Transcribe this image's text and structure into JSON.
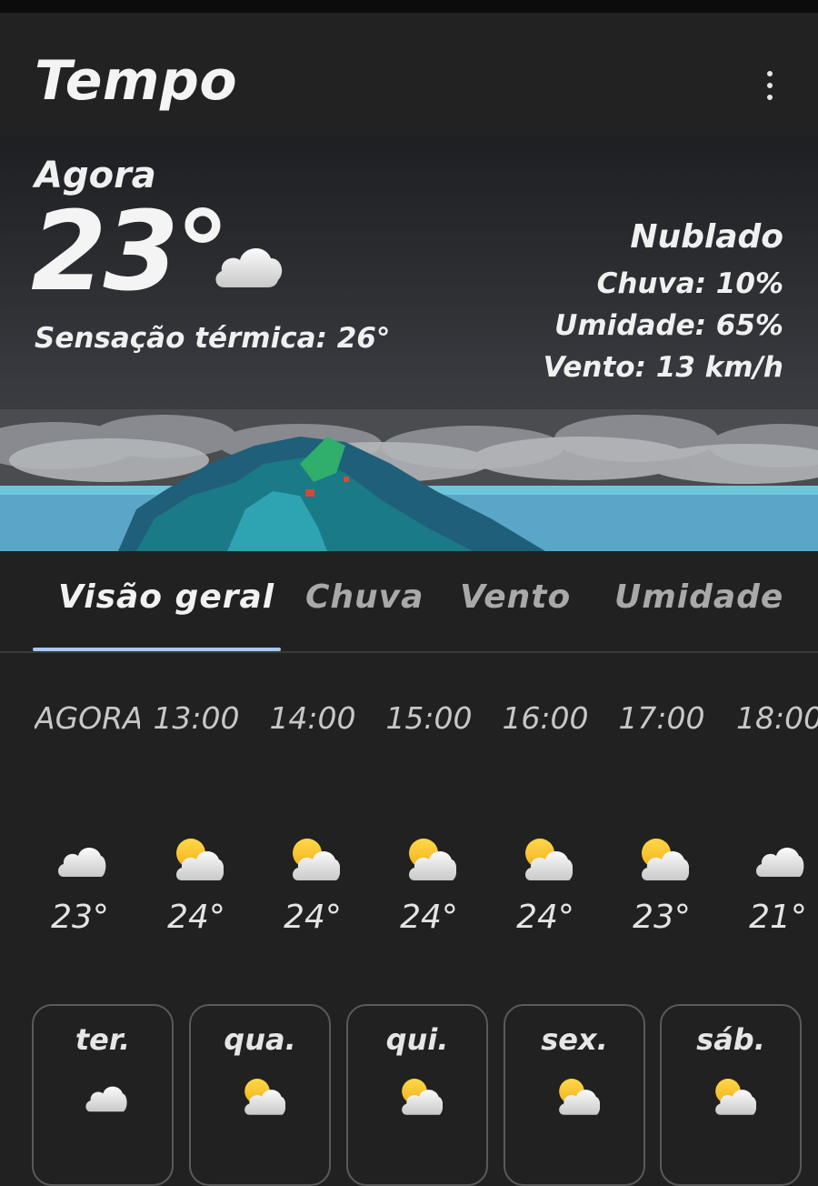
{
  "app": {
    "title": "Tempo"
  },
  "current": {
    "label": "Agora",
    "temperature": "23°",
    "condition_icon": "cloud-icon",
    "feels_like": "Sensação térmica: 26°",
    "description": "Nublado",
    "rain": "Chuva: 10%",
    "humidity": "Umidade: 65%",
    "wind": "Vento: 13 km/h"
  },
  "tabs": [
    {
      "label": "Visão geral",
      "active": true
    },
    {
      "label": "Chuva",
      "active": false
    },
    {
      "label": "Vento",
      "active": false
    },
    {
      "label": "Umidade",
      "active": false
    }
  ],
  "hourly": [
    {
      "time": "AGORA",
      "icon": "cloud-icon",
      "temp": "23°"
    },
    {
      "time": "13:00",
      "icon": "partly-cloudy-icon",
      "temp": "24°"
    },
    {
      "time": "14:00",
      "icon": "partly-cloudy-icon",
      "temp": "24°"
    },
    {
      "time": "15:00",
      "icon": "partly-cloudy-icon",
      "temp": "24°"
    },
    {
      "time": "16:00",
      "icon": "partly-cloudy-icon",
      "temp": "24°"
    },
    {
      "time": "17:00",
      "icon": "partly-cloudy-icon",
      "temp": "23°"
    },
    {
      "time": "18:00",
      "icon": "cloud-icon",
      "temp": "21°"
    }
  ],
  "daily": [
    {
      "day": "ter.",
      "icon": "cloud-icon"
    },
    {
      "day": "qua.",
      "icon": "partly-cloudy-icon"
    },
    {
      "day": "qui.",
      "icon": "partly-cloudy-icon"
    },
    {
      "day": "sex.",
      "icon": "partly-cloudy-icon"
    },
    {
      "day": "sáb.",
      "icon": "partly-cloudy-icon"
    }
  ],
  "colors": {
    "background": "#212121",
    "tab_indicator": "#a8c6f6",
    "sun": "#f9c62b",
    "cloud": "#e8e8e8"
  }
}
